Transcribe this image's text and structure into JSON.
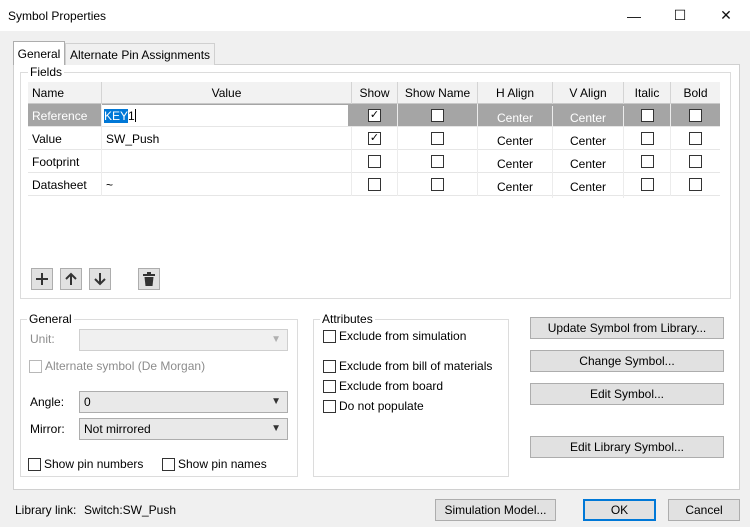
{
  "window": {
    "title": "Symbol Properties",
    "minimize": "—",
    "maximize": "☐",
    "close": "✕"
  },
  "tabs": [
    "General",
    "Alternate Pin Assignments"
  ],
  "fields": {
    "group_label": "Fields",
    "columns": [
      "Name",
      "Value",
      "Show",
      "Show Name",
      "H Align",
      "V Align",
      "Italic",
      "Bold"
    ],
    "rows": [
      {
        "name": "Reference",
        "value": "KEY1",
        "value_selected": "KEY",
        "value_rest": "1",
        "show": true,
        "show_name": false,
        "h_align": "Center",
        "v_align": "Center",
        "italic": false,
        "bold": false
      },
      {
        "name": "Value",
        "value": "SW_Push",
        "show": true,
        "show_name": false,
        "h_align": "Center",
        "v_align": "Center",
        "italic": false,
        "bold": false
      },
      {
        "name": "Footprint",
        "value": "",
        "show": false,
        "show_name": false,
        "h_align": "Center",
        "v_align": "Center",
        "italic": false,
        "bold": false
      },
      {
        "name": "Datasheet",
        "value": "~",
        "show": false,
        "show_name": false,
        "h_align": "Center",
        "v_align": "Center",
        "italic": false,
        "bold": false
      }
    ],
    "icons": [
      "add-icon",
      "move-up-icon",
      "move-down-icon",
      "delete-icon"
    ]
  },
  "general": {
    "group_label": "General",
    "unit_label": "Unit:",
    "unit_value": "",
    "alternate_symbol": "Alternate symbol (De Morgan)",
    "angle_label": "Angle:",
    "angle_value": "0",
    "mirror_label": "Mirror:",
    "mirror_value": "Not mirrored",
    "show_pin_numbers": "Show pin numbers",
    "show_pin_names": "Show pin names"
  },
  "attributes": {
    "group_label": "Attributes",
    "exclude_sim": "Exclude from simulation",
    "exclude_bom": "Exclude from bill of materials",
    "exclude_board": "Exclude from board",
    "do_not_populate": "Do not populate"
  },
  "actions": {
    "update_symbol": "Update Symbol from Library...",
    "change_symbol": "Change Symbol...",
    "edit_symbol": "Edit Symbol...",
    "edit_library_symbol": "Edit Library Symbol..."
  },
  "footer": {
    "library_link_label": "Library link:",
    "library_link_value": "Switch:SW_Push",
    "simulation_model": "Simulation Model...",
    "ok": "OK",
    "cancel": "Cancel"
  },
  "colors": {
    "accent": "#0078d7",
    "selected_row": "#a5a5a5"
  }
}
